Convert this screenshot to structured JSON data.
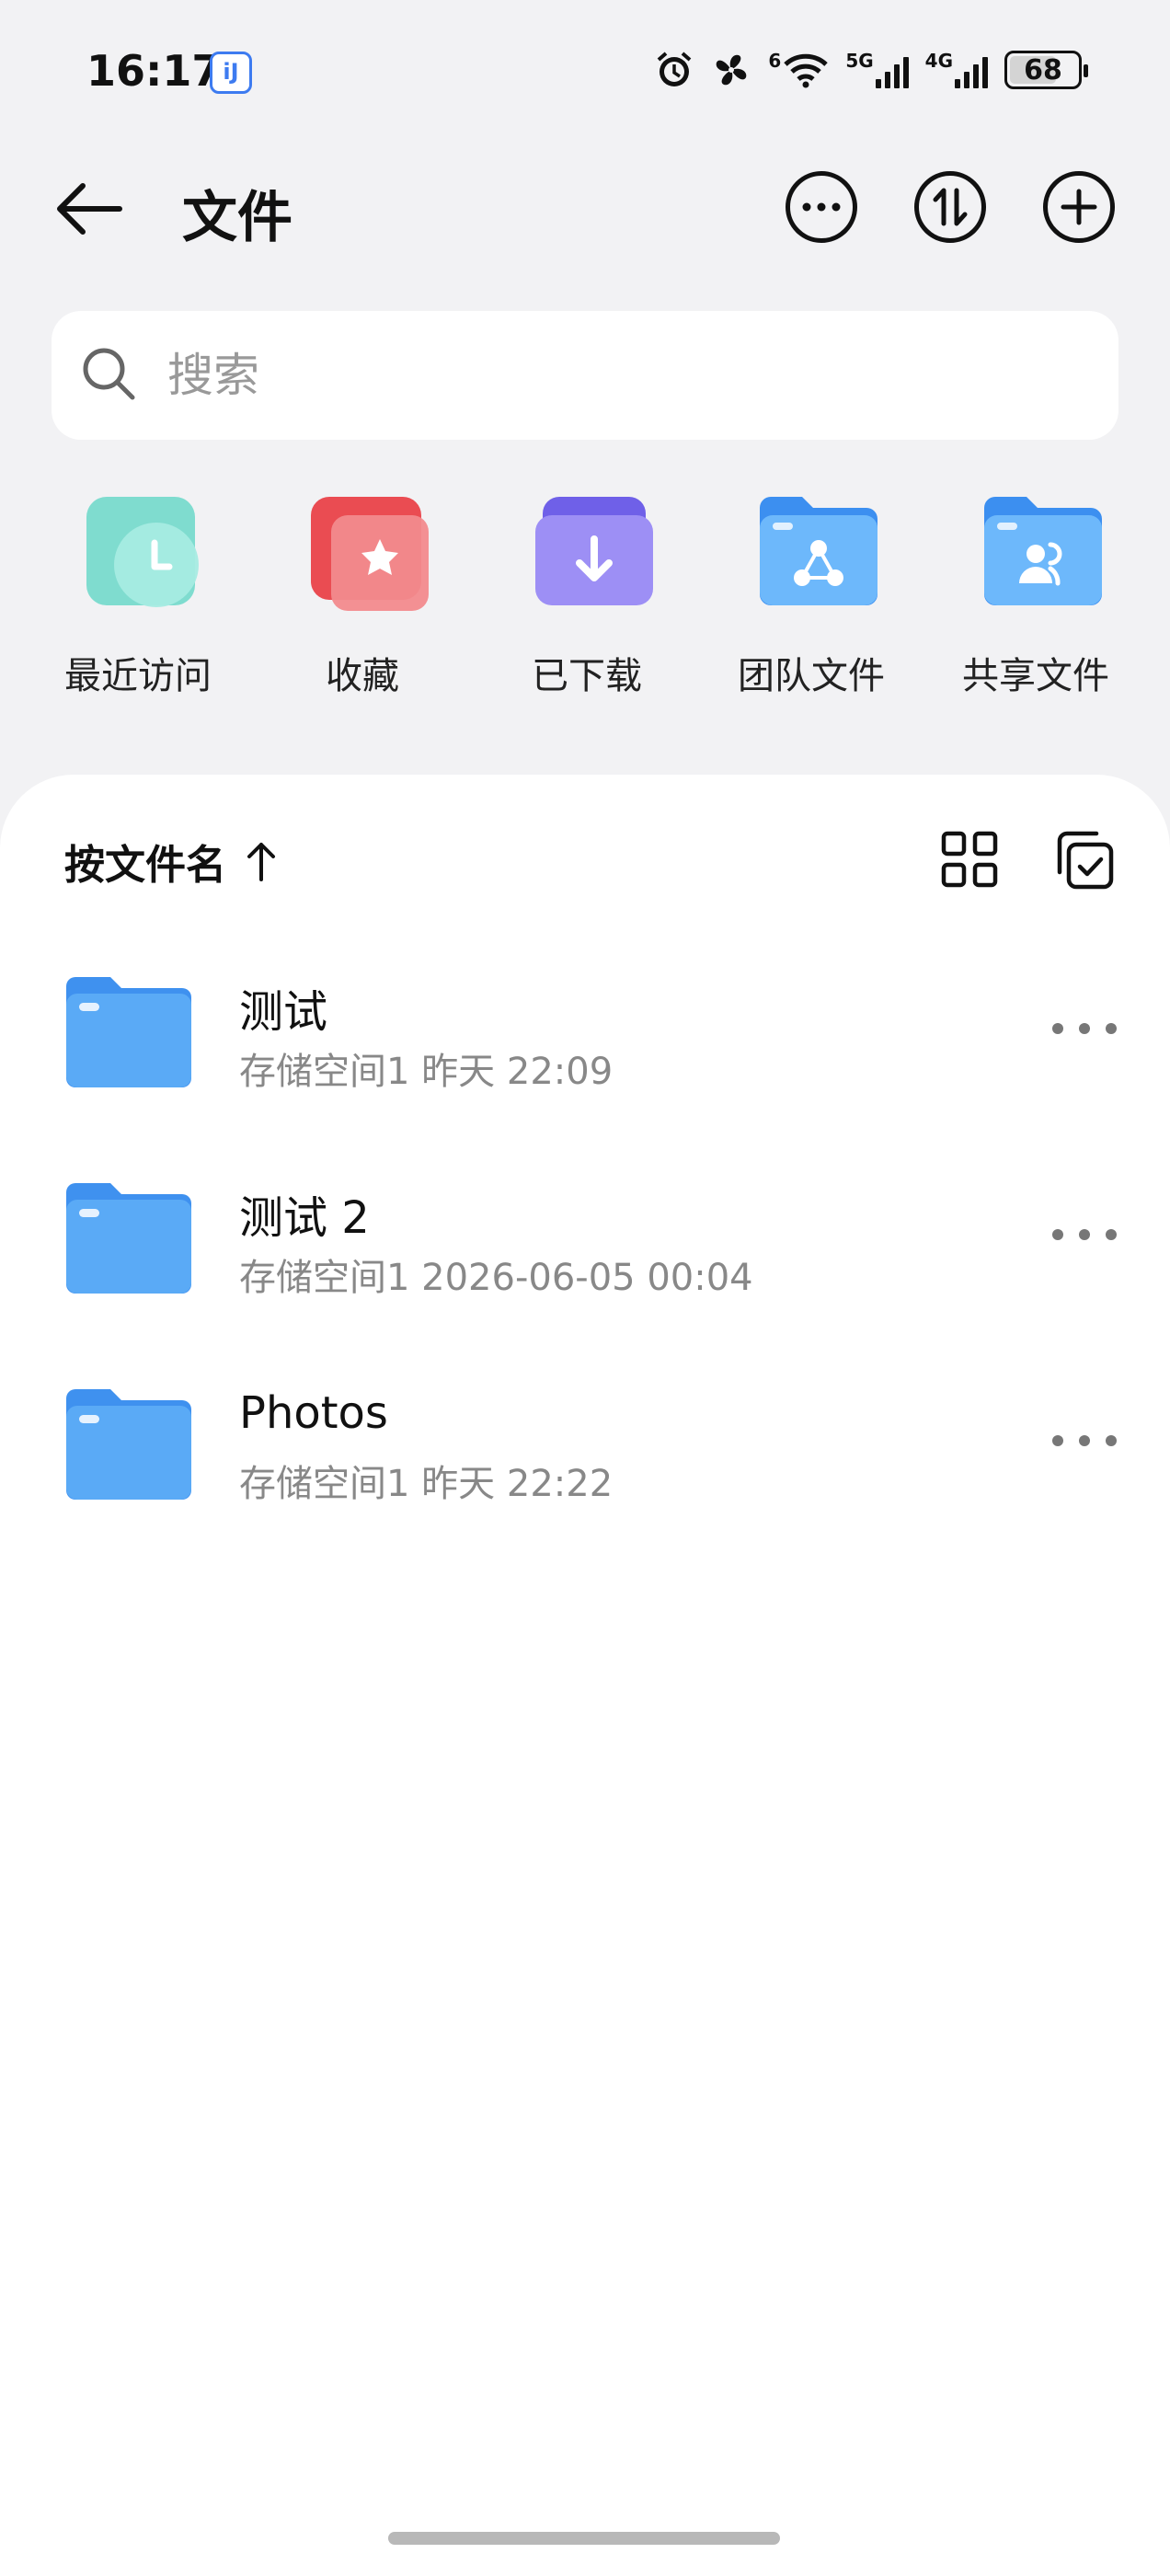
{
  "status_bar": {
    "time": "16:17",
    "app_badge": "iJ",
    "signal_5g": "5G",
    "signal_4g": "4G",
    "wifi_label": "6",
    "battery": "68"
  },
  "header": {
    "title": "文件",
    "icons": [
      "back-arrow-icon",
      "more-icon",
      "transfer-icon",
      "add-icon"
    ]
  },
  "search": {
    "placeholder": "搜索",
    "value": ""
  },
  "shortcuts": [
    {
      "label": "最近访问",
      "icon": "recent-clock-icon",
      "color": "#6fd6c8"
    },
    {
      "label": "收藏",
      "icon": "favorite-star-icon",
      "color": "#ef5e62"
    },
    {
      "label": "已下载",
      "icon": "download-icon",
      "color": "#7a6ff0"
    },
    {
      "label": "团队文件",
      "icon": "team-folder-icon",
      "color": "#4aa3f5"
    },
    {
      "label": "共享文件",
      "icon": "shared-folder-icon",
      "color": "#4aa3f5"
    }
  ],
  "list": {
    "sort_label": "按文件名",
    "files": [
      {
        "name": "测试",
        "meta": "存储空间1 昨天 22:09"
      },
      {
        "name": "测试 2",
        "meta": "存储空间1  2026-06-05 00:04"
      },
      {
        "name": "Photos",
        "meta": "存储空间1 昨天 22:22"
      }
    ]
  },
  "colors": {
    "folder_blue": "#4ea5f3",
    "background": "#f2f2f4",
    "panel": "#ffffff"
  }
}
